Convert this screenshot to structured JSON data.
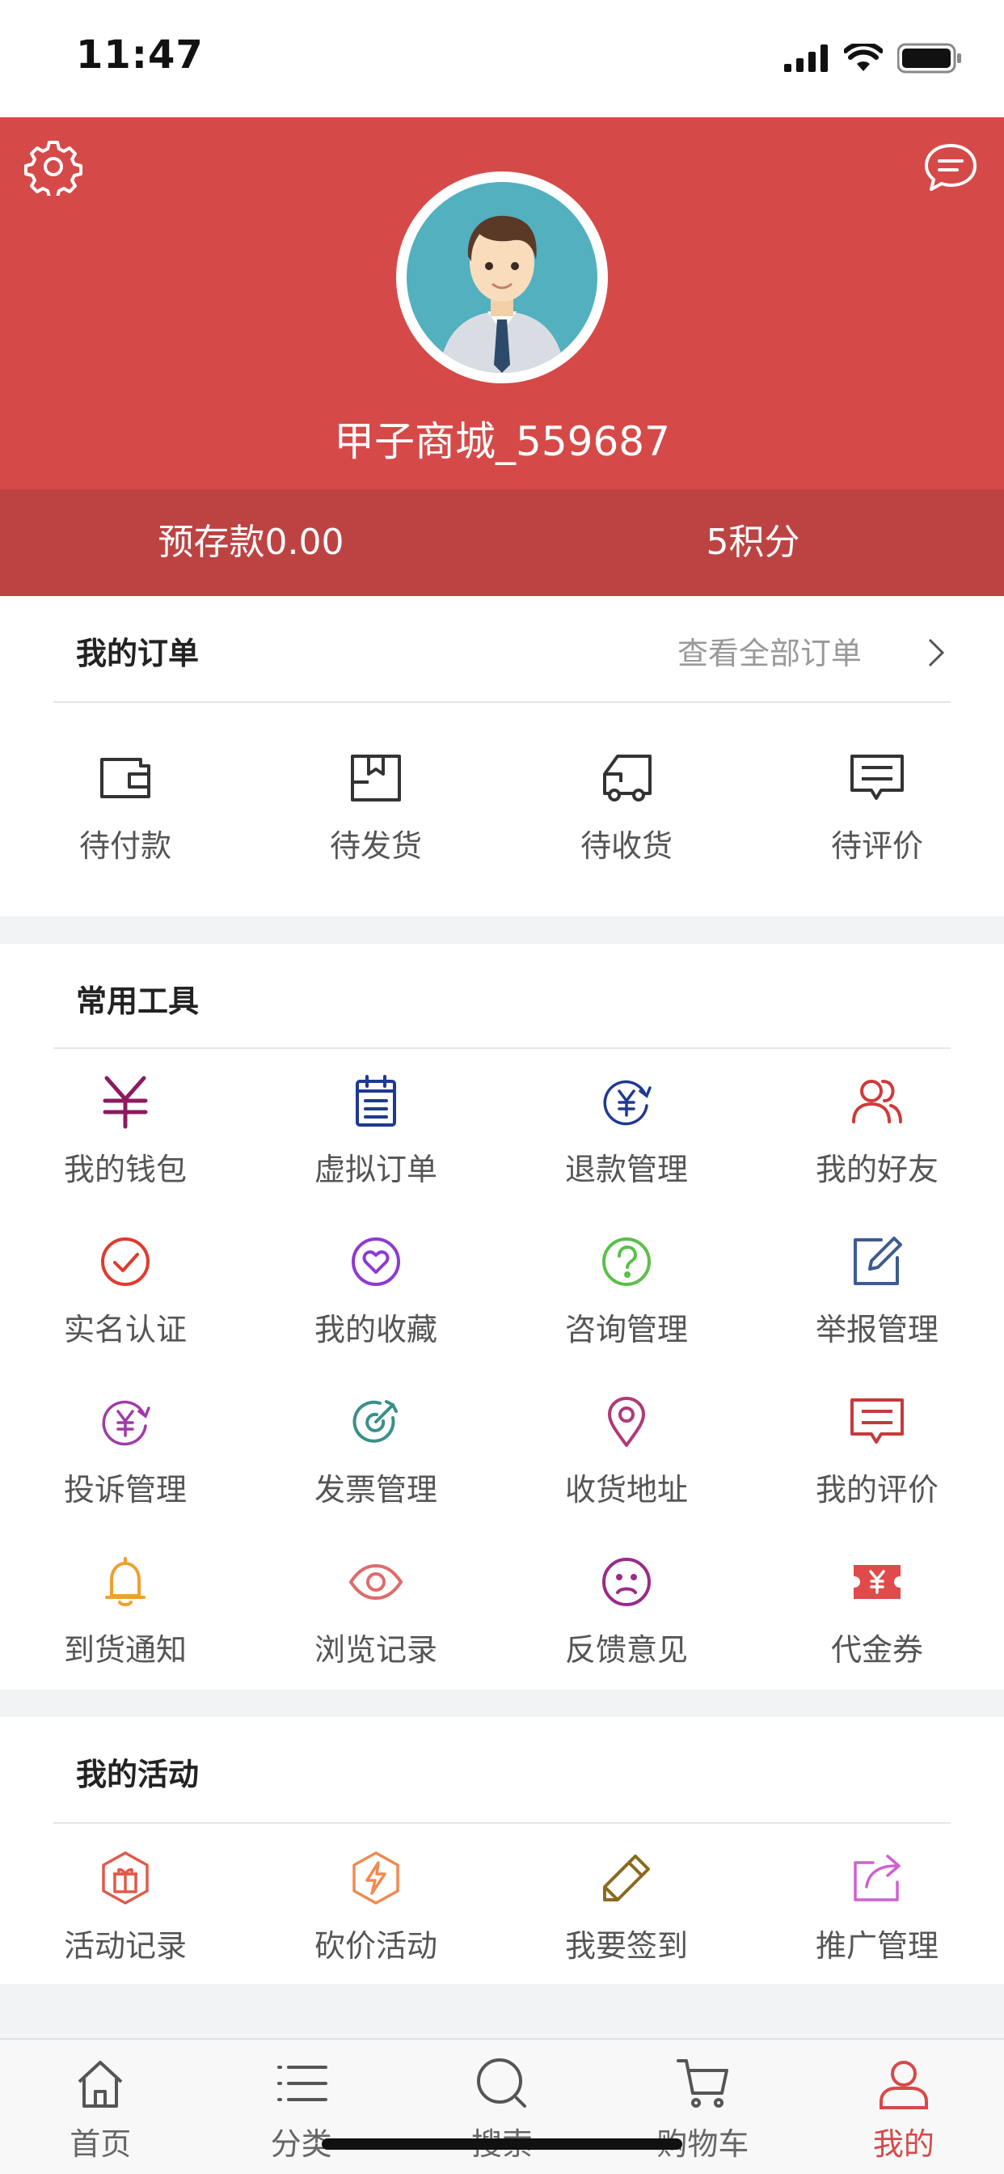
{
  "status_bar": {
    "time": "11:47"
  },
  "profile": {
    "username": "甲子商城_559687",
    "deposit": "预存款0.00",
    "points": "5积分"
  },
  "orders": {
    "title": "我的订单",
    "view_all": "查看全部订单",
    "items": [
      {
        "label": "待付款",
        "icon": "wallet-icon"
      },
      {
        "label": "待发货",
        "icon": "box-icon"
      },
      {
        "label": "待收货",
        "icon": "truck-icon"
      },
      {
        "label": "待评价",
        "icon": "comment-icon"
      }
    ]
  },
  "tools": {
    "title": "常用工具",
    "items": [
      {
        "label": "我的钱包",
        "icon": "yen-icon",
        "color": "#8b1b5f"
      },
      {
        "label": "虚拟订单",
        "icon": "clipboard-icon",
        "color": "#1f3a93"
      },
      {
        "label": "退款管理",
        "icon": "refund-icon",
        "color": "#1f3a93"
      },
      {
        "label": "我的好友",
        "icon": "friends-icon",
        "color": "#d03a3a"
      },
      {
        "label": "实名认证",
        "icon": "check-circle-icon",
        "color": "#e03a2f"
      },
      {
        "label": "我的收藏",
        "icon": "heart-icon",
        "color": "#8e3ad0"
      },
      {
        "label": "咨询管理",
        "icon": "question-icon",
        "color": "#5cbf4a"
      },
      {
        "label": "举报管理",
        "icon": "edit-icon",
        "color": "#3d5b8f"
      },
      {
        "label": "投诉管理",
        "icon": "complaint-icon",
        "color": "#a03aa8"
      },
      {
        "label": "发票管理",
        "icon": "target-icon",
        "color": "#3a8f8a"
      },
      {
        "label": "收货地址",
        "icon": "location-icon",
        "color": "#b03a7a"
      },
      {
        "label": "我的评价",
        "icon": "review-icon",
        "color": "#c73a3a"
      },
      {
        "label": "到货通知",
        "icon": "bell-icon",
        "color": "#f0a030"
      },
      {
        "label": "浏览记录",
        "icon": "eye-icon",
        "color": "#e06a6a"
      },
      {
        "label": "反馈意见",
        "icon": "sad-face-icon",
        "color": "#9b2a8a"
      },
      {
        "label": "代金券",
        "icon": "coupon-icon",
        "color": "#e04a4a"
      }
    ]
  },
  "activities": {
    "title": "我的活动",
    "items": [
      {
        "label": "活动记录",
        "icon": "gift-icon",
        "color": "#e05a4a"
      },
      {
        "label": "砍价活动",
        "icon": "bolt-icon",
        "color": "#f08a50"
      },
      {
        "label": "我要签到",
        "icon": "pencil-icon",
        "color": "#8a6a20"
      },
      {
        "label": "推广管理",
        "icon": "share-icon",
        "color": "#d060d0"
      }
    ]
  },
  "tabbar": {
    "items": [
      {
        "label": "首页",
        "icon": "home-icon"
      },
      {
        "label": "分类",
        "icon": "list-icon"
      },
      {
        "label": "搜索",
        "icon": "search-icon"
      },
      {
        "label": "购物车",
        "icon": "cart-icon"
      },
      {
        "label": "我的",
        "icon": "user-icon"
      }
    ],
    "active_color": "#d54a48"
  }
}
